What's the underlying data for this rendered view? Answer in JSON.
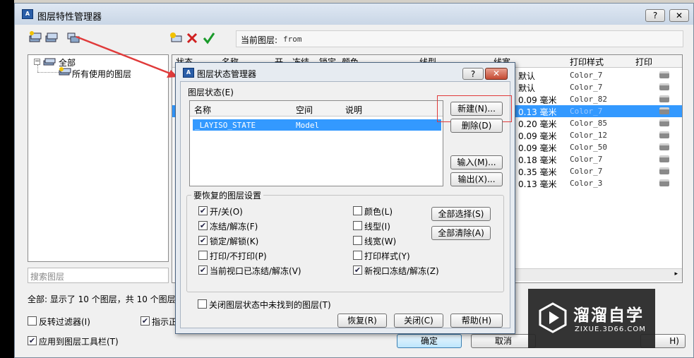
{
  "outer": {
    "title": "图层特性管理器",
    "help_btn": "?",
    "close_btn": "✕",
    "current_layer_label": "当前图层:",
    "current_layer_value": "from",
    "tree": {
      "root": "全部",
      "child": "所有使用的图层"
    },
    "search_placeholder": "搜索图层",
    "columns_visible": {
      "status": "状态",
      "name": "名称",
      "on": "开",
      "freeze": "冻结",
      "lock": "锁定",
      "color": "颜色",
      "linetype": "线型",
      "lineweight": "线宽",
      "plotstyle": "打印样式",
      "plot": "打印"
    },
    "rows": [
      {
        "lw": "默认",
        "ps": "Color_7",
        "selected": false
      },
      {
        "lw": "默认",
        "ps": "Color_7",
        "selected": false
      },
      {
        "lw": "0.09 毫米",
        "ps": "Color_82",
        "selected": false
      },
      {
        "lw": "0.13 毫米",
        "ps": "Color_7",
        "selected": true
      },
      {
        "lw": "0.20 毫米",
        "ps": "Color_85",
        "selected": false
      },
      {
        "lw": "0.09 毫米",
        "ps": "Color_12",
        "selected": false
      },
      {
        "lw": "0.09 毫米",
        "ps": "Color_50",
        "selected": false
      },
      {
        "lw": "0.18 毫米",
        "ps": "Color_7",
        "selected": false
      },
      {
        "lw": "0.35 毫米",
        "ps": "Color_7",
        "selected": false
      },
      {
        "lw": "0.13 毫米",
        "ps": "Color_3",
        "selected": false
      }
    ],
    "status_text": "全部: 显示了 10 个图层，共 10 个图层",
    "invert_filter": "反转过滤器(I)",
    "indicate_used": "指示正",
    "apply_to_toolbar": "应用到图层工具栏(T)",
    "ok": "确定",
    "cancel": "取消",
    "help_partial": "H)"
  },
  "inner": {
    "title": "图层状态管理器",
    "help_btn": "?",
    "close_btn": "✕",
    "states_label": "图层状态(E)",
    "col_name": "名称",
    "col_space": "空间",
    "col_desc": "说明",
    "state_row": {
      "name": "_LAYISO_STATE",
      "space": "Model",
      "desc": ""
    },
    "btn_new": "新建(N)...",
    "btn_delete": "删除(D)",
    "btn_import": "输入(M)...",
    "btn_export": "输出(X)...",
    "restore_group": "要恢复的图层设置",
    "settings_left": [
      {
        "label": "开/关(O)",
        "checked": true
      },
      {
        "label": "冻结/解冻(F)",
        "checked": true
      },
      {
        "label": "锁定/解锁(K)",
        "checked": true
      },
      {
        "label": "打印/不打印(P)",
        "checked": false
      },
      {
        "label": "当前视口已冻结/解冻(V)",
        "checked": true
      }
    ],
    "settings_right": [
      {
        "label": "颜色(L)",
        "checked": false
      },
      {
        "label": "线型(I)",
        "checked": false
      },
      {
        "label": "线宽(W)",
        "checked": false
      },
      {
        "label": "打印样式(Y)",
        "checked": false
      },
      {
        "label": "新视口冻结/解冻(Z)",
        "checked": true
      }
    ],
    "select_all": "全部选择(S)",
    "clear_all": "全部清除(A)",
    "close_missing": "关闭图层状态中未找到的图层(T)",
    "close_missing_checked": false,
    "btn_restore": "恢复(R)",
    "btn_close": "关闭(C)",
    "btn_help": "帮助(H)"
  },
  "watermark": {
    "brand": "溜溜自学",
    "url": "ZIXUE.3D66.COM"
  },
  "colors": {
    "selection": "#3399ff",
    "arrow": "#e03a3a",
    "highlight_box": "#e03a3a"
  }
}
